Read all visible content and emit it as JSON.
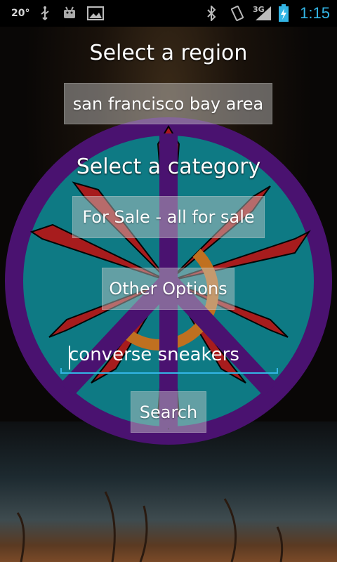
{
  "status_bar": {
    "temperature": "20°",
    "time": "1:15",
    "network": "3G",
    "icons": [
      "usb-icon",
      "android-debug-icon",
      "image-icon",
      "bluetooth-icon",
      "vibrate-icon",
      "signal-icon",
      "battery-charging-icon"
    ]
  },
  "region": {
    "heading": "Select a region",
    "selected": "san francisco bay area"
  },
  "category": {
    "heading": "Select a category",
    "selected": "For Sale - all for sale"
  },
  "other_options_label": "Other Options",
  "search": {
    "value": "converse sneakers",
    "button_label": "Search"
  },
  "colors": {
    "accent": "#33b5e5",
    "button_bg": "rgba(205,205,205,0.45)"
  }
}
